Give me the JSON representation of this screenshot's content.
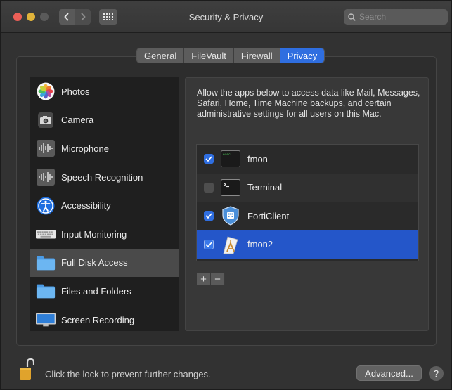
{
  "window": {
    "title": "Security & Privacy"
  },
  "search": {
    "placeholder": "Search"
  },
  "tabs": [
    {
      "label": "General",
      "active": false
    },
    {
      "label": "FileVault",
      "active": false
    },
    {
      "label": "Firewall",
      "active": false
    },
    {
      "label": "Privacy",
      "active": true
    }
  ],
  "sidebar": {
    "items": [
      {
        "label": "Photos",
        "icon": "photos-icon"
      },
      {
        "label": "Camera",
        "icon": "camera-icon"
      },
      {
        "label": "Microphone",
        "icon": "microphone-icon"
      },
      {
        "label": "Speech Recognition",
        "icon": "speech-recognition-icon"
      },
      {
        "label": "Accessibility",
        "icon": "accessibility-icon"
      },
      {
        "label": "Input Monitoring",
        "icon": "keyboard-icon"
      },
      {
        "label": "Full Disk Access",
        "icon": "folder-icon",
        "selected": true
      },
      {
        "label": "Files and Folders",
        "icon": "folder-icon"
      },
      {
        "label": "Screen Recording",
        "icon": "display-icon"
      }
    ]
  },
  "main": {
    "description": "Allow the apps below to access data like Mail, Messages, Safari, Home, Time Machine backups, and certain administrative settings for all users on this Mac.",
    "apps": [
      {
        "label": "fmon",
        "checked": true,
        "icon": "terminal-exec-icon"
      },
      {
        "label": "Terminal",
        "checked": false,
        "icon": "terminal-icon"
      },
      {
        "label": "FortiClient",
        "checked": true,
        "icon": "forticlient-shield-icon"
      },
      {
        "label": "fmon2",
        "checked": true,
        "icon": "app-generic-icon",
        "selected": true
      }
    ],
    "add_label": "+",
    "remove_label": "−"
  },
  "footer": {
    "lock_text": "Click the lock to prevent further changes.",
    "advanced_label": "Advanced...",
    "help_label": "?"
  },
  "colors": {
    "accent": "#2f6ee0",
    "selected_row": "#2456c9",
    "close": "#ec5f57",
    "minimize": "#e0b33a"
  }
}
